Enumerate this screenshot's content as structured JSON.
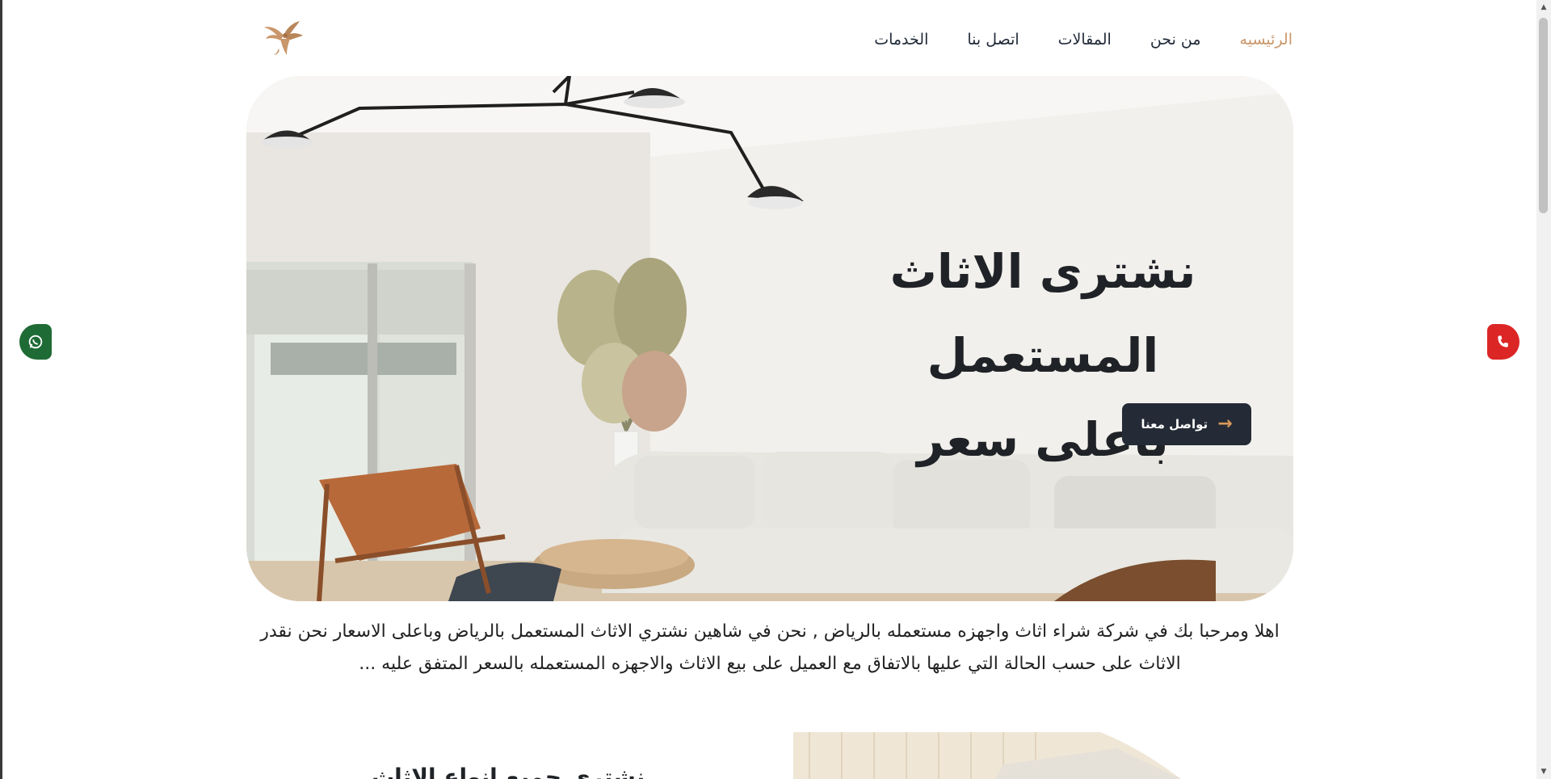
{
  "nav": {
    "items": [
      {
        "label": "الرئيسيه",
        "active": true
      },
      {
        "label": "من نحن",
        "active": false
      },
      {
        "label": "المقالات",
        "active": false
      },
      {
        "label": "اتصل بنا",
        "active": false
      },
      {
        "label": "الخدمات",
        "active": false
      }
    ],
    "logo_icon": "eagle-logo-icon"
  },
  "hero": {
    "title_line1": "نشترى الاثاث المستعمل",
    "title_line2": "باعلى سعر",
    "cta_label": "تواصل معنا",
    "cta_icon": "arrow-left-icon"
  },
  "intro": {
    "text": "اهلا ومرحبا بك في شركة شراء اثاث واجهزه مستعمله بالرياض , نحن في شاهين نشتري الاثاث المستعمل بالرياض وباعلى الاسعار نحن نقدر الاثاث على حسب الحالة التي عليها بالاتفاق مع العميل على بيع الاثاث والاجهزه المستعمله بالسعر المتفق عليه ..."
  },
  "section": {
    "title": "نشتري جميع انواع الاثاث"
  },
  "floating": {
    "whatsapp_icon": "whatsapp-icon",
    "phone_icon": "phone-icon"
  },
  "colors": {
    "accent": "#c9976b",
    "button_dark": "#252b36",
    "whatsapp": "#1f6b35",
    "phone": "#dc2626"
  }
}
